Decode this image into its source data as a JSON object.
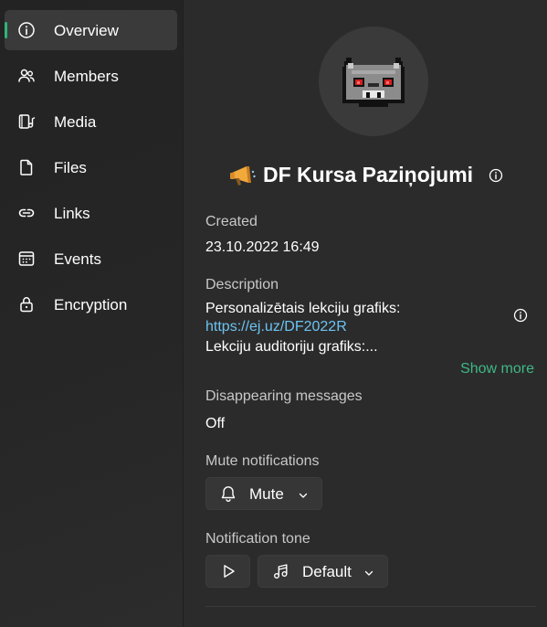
{
  "nav": {
    "items": [
      {
        "label": "Overview",
        "icon": "info-icon",
        "active": true
      },
      {
        "label": "Members",
        "icon": "people-icon",
        "active": false
      },
      {
        "label": "Media",
        "icon": "media-icon",
        "active": false
      },
      {
        "label": "Files",
        "icon": "file-icon",
        "active": false
      },
      {
        "label": "Links",
        "icon": "link-icon",
        "active": false
      },
      {
        "label": "Events",
        "icon": "calendar-icon",
        "active": false
      },
      {
        "label": "Encryption",
        "icon": "lock-icon",
        "active": false
      }
    ],
    "accent": "#2fb37a"
  },
  "group": {
    "emoji": "📣",
    "name": "DF Kursa Paziņojumi"
  },
  "created": {
    "label": "Created",
    "value": "23.10.2022 16:49"
  },
  "description": {
    "label": "Description",
    "line1": "Personalizētais lekciju grafiks:",
    "link": "https://ej.uz/DF2022R",
    "line3": "Lekciju auditoriju grafiks:...",
    "show_more": "Show more"
  },
  "disappearing": {
    "label": "Disappearing messages",
    "value": "Off"
  },
  "mute": {
    "label": "Mute notifications",
    "button": "Mute"
  },
  "tone": {
    "label": "Notification tone",
    "value": "Default"
  },
  "colors": {
    "link": "#6cc3f2",
    "show_more": "#3fb886"
  }
}
